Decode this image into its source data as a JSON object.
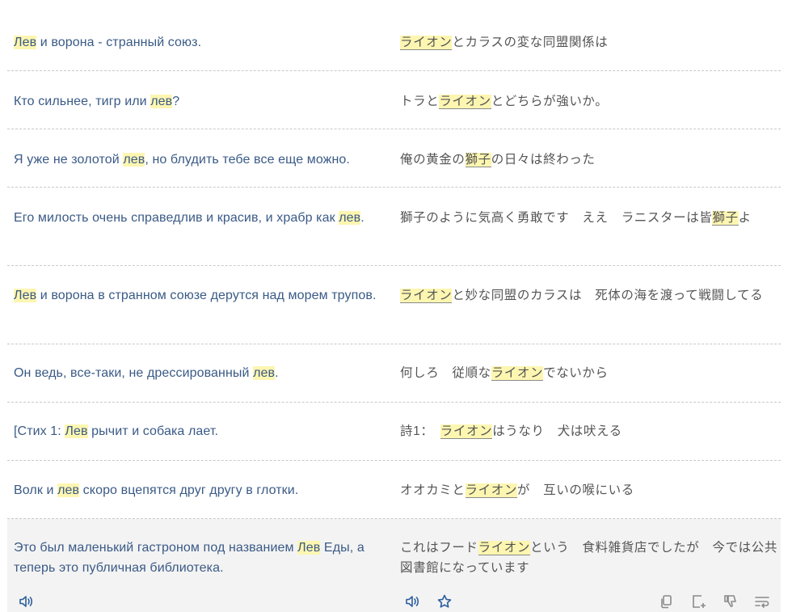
{
  "rows": [
    {
      "src": [
        {
          "t": "Лев",
          "h": true
        },
        {
          "t": " и ворона - странный союз."
        }
      ],
      "tgt": [
        {
          "t": "ライオン",
          "h": true
        },
        {
          "t": "とカラスの変な同盟関係は"
        }
      ]
    },
    {
      "src": [
        {
          "t": "Кто сильнее, тигр или "
        },
        {
          "t": "лев",
          "h": true
        },
        {
          "t": "?"
        }
      ],
      "tgt": [
        {
          "t": "トラと"
        },
        {
          "t": "ライオン",
          "h": true
        },
        {
          "t": "とどちらが強いか。"
        }
      ]
    },
    {
      "src": [
        {
          "t": "Я уже не золотой "
        },
        {
          "t": "лев",
          "h": true
        },
        {
          "t": ", но блудить тебе все еще можно."
        }
      ],
      "tgt": [
        {
          "t": "俺の黄金の"
        },
        {
          "t": "獅子",
          "h": true
        },
        {
          "t": "の日々は終わった"
        }
      ]
    },
    {
      "src": [
        {
          "t": "Его милость очень справедлив и красив, и храбр как "
        },
        {
          "t": "лев",
          "h": true
        },
        {
          "t": "."
        }
      ],
      "tgt": [
        {
          "t": "獅子のように気高く勇敢です　ええ　ラニスターは皆"
        },
        {
          "t": "獅子",
          "h": true
        },
        {
          "t": "よ"
        }
      ]
    },
    {
      "src": [
        {
          "t": "Лев",
          "h": true
        },
        {
          "t": " и ворона в странном союзе дерутся над морем трупов."
        }
      ],
      "tgt": [
        {
          "t": "ライオン",
          "h": true
        },
        {
          "t": "と妙な同盟のカラスは　死体の海を渡って戦闘してる"
        }
      ]
    },
    {
      "src": [
        {
          "t": "Он ведь, все-таки, не дрессированный "
        },
        {
          "t": "лев",
          "h": true
        },
        {
          "t": "."
        }
      ],
      "tgt": [
        {
          "t": "何しろ　従順な"
        },
        {
          "t": "ライオン",
          "h": true
        },
        {
          "t": "でないから"
        }
      ]
    },
    {
      "src": [
        {
          "t": "[Стих 1: "
        },
        {
          "t": "Лев",
          "h": true
        },
        {
          "t": " рычит и собака лает."
        }
      ],
      "tgt": [
        {
          "t": "詩1：　"
        },
        {
          "t": "ライオン",
          "h": true
        },
        {
          "t": "はうなり　犬は吠える"
        }
      ]
    },
    {
      "src": [
        {
          "t": "Волк и "
        },
        {
          "t": "лев",
          "h": true
        },
        {
          "t": " скоро вцепятся друг другу в глотки."
        }
      ],
      "tgt": [
        {
          "t": "オオカミと"
        },
        {
          "t": "ライオン",
          "h": true
        },
        {
          "t": "が　互いの喉にいる"
        }
      ]
    },
    {
      "src": [
        {
          "t": "Это был маленький гастроном под названием "
        },
        {
          "t": "Лев",
          "h": true
        },
        {
          "t": " Еды, а теперь это публичная библиотека."
        }
      ],
      "tgt": [
        {
          "t": "これはフード"
        },
        {
          "t": "ライオン",
          "h": true
        },
        {
          "t": "という　食料雑貨店でしたが　今では公共図書館になっています"
        }
      ]
    }
  ],
  "toolbar": {
    "icons": [
      "speaker-icon",
      "speaker-icon",
      "star-icon",
      "copy-icon",
      "add-to-list-icon",
      "thumbs-down-icon",
      "wrap-lines-icon"
    ],
    "accent": "#2d5e9e"
  }
}
